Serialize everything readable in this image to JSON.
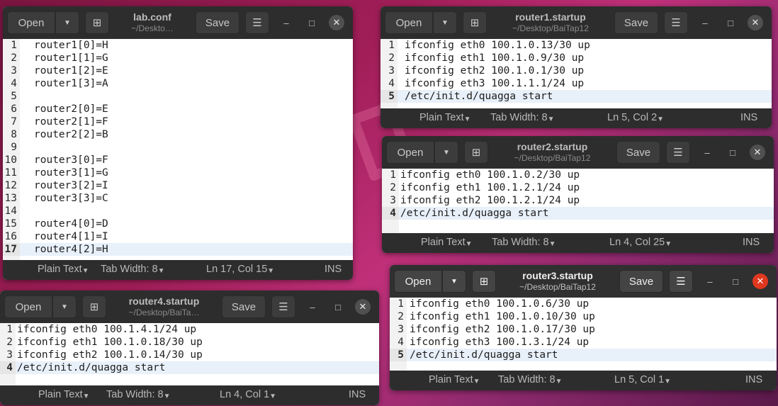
{
  "colors": {
    "accent_close": "#e0371f",
    "header": "#303030",
    "current_line": "#e8f0fa"
  },
  "common": {
    "open_label": "Open",
    "save_label": "Save",
    "open_arrow_icon": "chevron-down-icon",
    "new_tab_icon": "new-tab-icon",
    "menu_icon": "hamburger-menu-icon",
    "minimize_glyph": "–",
    "maximize_glyph": "□",
    "close_glyph": "✕"
  },
  "windows": {
    "lab": {
      "title": "lab.conf",
      "subtitle": "~/Deskto…",
      "lines": [
        "router1[0]=H",
        "router1[1]=G",
        "router1[2]=E",
        "router1[3]=A",
        "",
        "router2[0]=E",
        "router2[1]=F",
        "router2[2]=B",
        "",
        "router3[0]=F",
        "router3[1]=G",
        "router3[2]=I",
        "router3[3]=C",
        "",
        "router4[0]=D",
        "router4[1]=I",
        "router4[2]=H"
      ],
      "current_line": 17,
      "status": {
        "lang": "Plain Text",
        "tab": "Tab Width: 8",
        "pos": "Ln 17, Col 15",
        "mode": "INS"
      }
    },
    "r1": {
      "title": "router1.startup",
      "subtitle": "~/Desktop/BaiTap12",
      "lines": [
        "ifconfig eth0 100.1.0.13/30 up",
        "ifconfig eth1 100.1.0.9/30 up",
        "ifconfig eth2 100.1.0.1/30 up",
        "ifconfig eth3 100.1.1.1/24 up",
        "/etc/init.d/quagga start"
      ],
      "current_line": 5,
      "status": {
        "lang": "Plain Text",
        "tab": "Tab Width: 8",
        "pos": "Ln 5, Col 2",
        "mode": "INS"
      }
    },
    "r2": {
      "title": "router2.startup",
      "subtitle": "~/Desktop/BaiTap12",
      "lines": [
        "ifconfig eth0 100.1.0.2/30 up",
        "ifconfig eth1 100.1.2.1/24 up",
        "ifconfig eth2 100.1.2.1/24 up",
        "/etc/init.d/quagga start"
      ],
      "current_line": 4,
      "status": {
        "lang": "Plain Text",
        "tab": "Tab Width: 8",
        "pos": "Ln 4, Col 25",
        "mode": "INS"
      }
    },
    "r3": {
      "title": "router3.startup",
      "subtitle": "~/Desktop/BaiTap12",
      "lines": [
        "ifconfig eth0 100.1.0.6/30 up",
        "ifconfig eth1 100.1.0.10/30 up",
        "ifconfig eth2 100.1.0.17/30 up",
        "ifconfig eth3 100.1.3.1/24 up",
        "/etc/init.d/quagga start"
      ],
      "current_line": 5,
      "status": {
        "lang": "Plain Text",
        "tab": "Tab Width: 8",
        "pos": "Ln 5, Col 1",
        "mode": "INS"
      }
    },
    "r4": {
      "title": "router4.startup",
      "subtitle": "~/Desktop/BaiTa…",
      "lines": [
        "ifconfig eth0 100.1.4.1/24 up",
        "ifconfig eth1 100.1.0.18/30 up",
        "ifconfig eth2 100.1.0.14/30 up",
        "/etc/init.d/quagga start"
      ],
      "current_line": 4,
      "status": {
        "lang": "Plain Text",
        "tab": "Tab Width: 8",
        "pos": "Ln 4, Col 1",
        "mode": "INS"
      }
    }
  }
}
